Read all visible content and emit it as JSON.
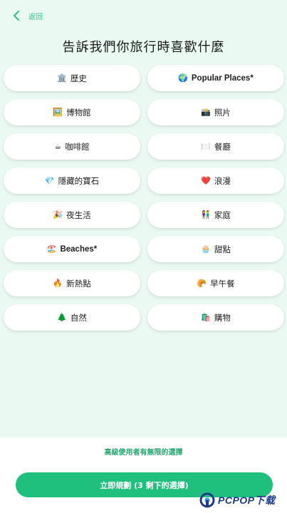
{
  "header": {
    "back_label": "返回",
    "title": "告訴我們你旅行時喜歡什麼"
  },
  "categories": [
    {
      "emoji": "🏛️",
      "label": "歷史",
      "icon": "museum-icon"
    },
    {
      "emoji": "🌍",
      "label": "Popular Places*",
      "icon": "globe-icon"
    },
    {
      "emoji": "🖼️",
      "label": "博物館",
      "icon": "framed-picture-icon"
    },
    {
      "emoji": "📸",
      "label": "照片",
      "icon": "camera-icon"
    },
    {
      "emoji": "☕",
      "label": "咖啡館",
      "icon": "coffee-icon"
    },
    {
      "emoji": "🍽️",
      "label": "餐廳",
      "icon": "plate-cutlery-icon"
    },
    {
      "emoji": "💎",
      "label": "隱藏的寶石",
      "icon": "gem-icon"
    },
    {
      "emoji": "❤️",
      "label": "浪漫",
      "icon": "heart-icon"
    },
    {
      "emoji": "🎉",
      "label": "夜生活",
      "icon": "party-popper-icon"
    },
    {
      "emoji": "👫",
      "label": "家庭",
      "icon": "family-icon"
    },
    {
      "emoji": "🏖️",
      "label": "Beaches*",
      "icon": "beach-icon"
    },
    {
      "emoji": "🧁",
      "label": "甜點",
      "icon": "cupcake-icon"
    },
    {
      "emoji": "🔥",
      "label": "新熱點",
      "icon": "fire-icon"
    },
    {
      "emoji": "🥐",
      "label": "早午餐",
      "icon": "croissant-icon"
    },
    {
      "emoji": "🌲",
      "label": "自然",
      "icon": "tree-icon"
    },
    {
      "emoji": "🛍️",
      "label": "購物",
      "icon": "shopping-bags-icon"
    }
  ],
  "premium_note": "高級使用者有無限的選擇",
  "cta": {
    "label": "立即規劃 (3 剩下的選擇)"
  },
  "watermark": {
    "text": "PCPOP下载"
  },
  "colors": {
    "background": "#eafaf3",
    "accent": "#1fbf7e",
    "accent_text": "#21a66f"
  }
}
